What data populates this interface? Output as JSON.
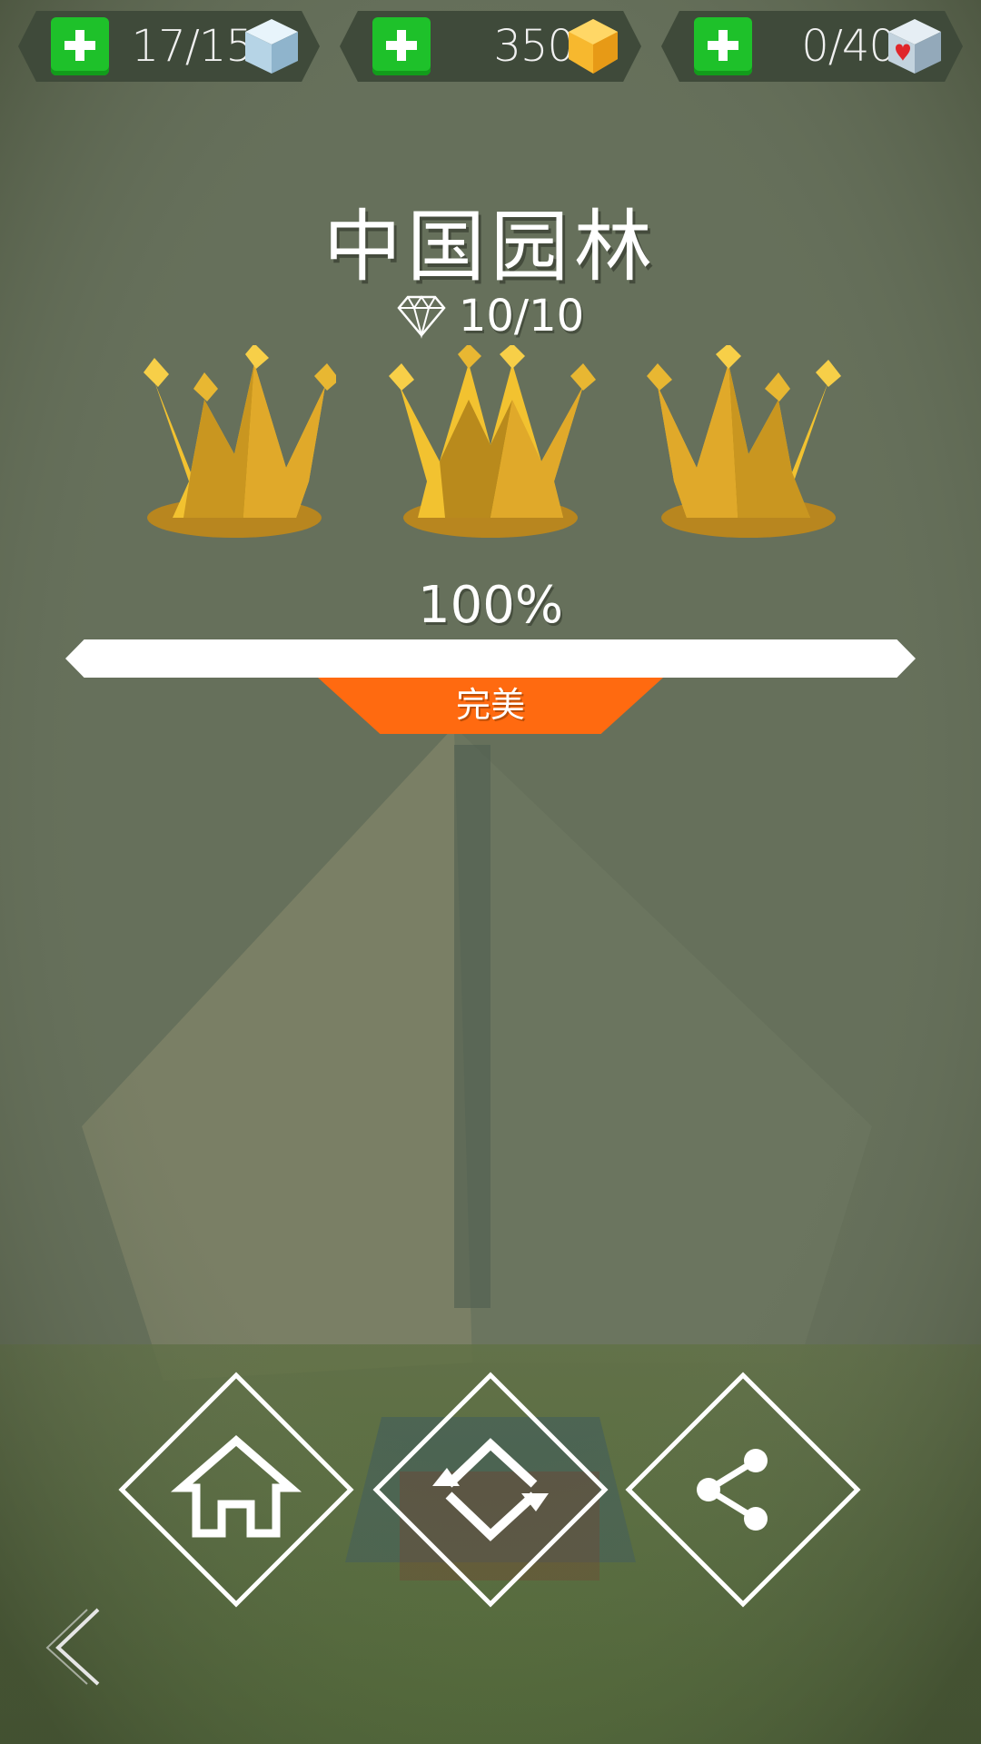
{
  "resources": [
    {
      "value": "17/15",
      "icon": "ice-cube-icon"
    },
    {
      "value": "350",
      "icon": "gold-gem-icon"
    },
    {
      "value": "0/40",
      "icon": "heart-cube-icon"
    }
  ],
  "level": {
    "title": "中国园林",
    "gems": "10/10",
    "crowns_earned": 3,
    "crowns_total": 3,
    "percent_label": "100%",
    "progress": 1.0,
    "rank_label": "完美"
  },
  "actions": [
    {
      "name": "home",
      "icon": "home-icon"
    },
    {
      "name": "replay",
      "icon": "replay-icon"
    },
    {
      "name": "share",
      "icon": "share-icon"
    }
  ],
  "nav": {
    "back_icon": "back-chevron-icon"
  },
  "colors": {
    "accent": "#ff6a10",
    "plus": "#1ec12a",
    "crown": "#f2c230"
  }
}
